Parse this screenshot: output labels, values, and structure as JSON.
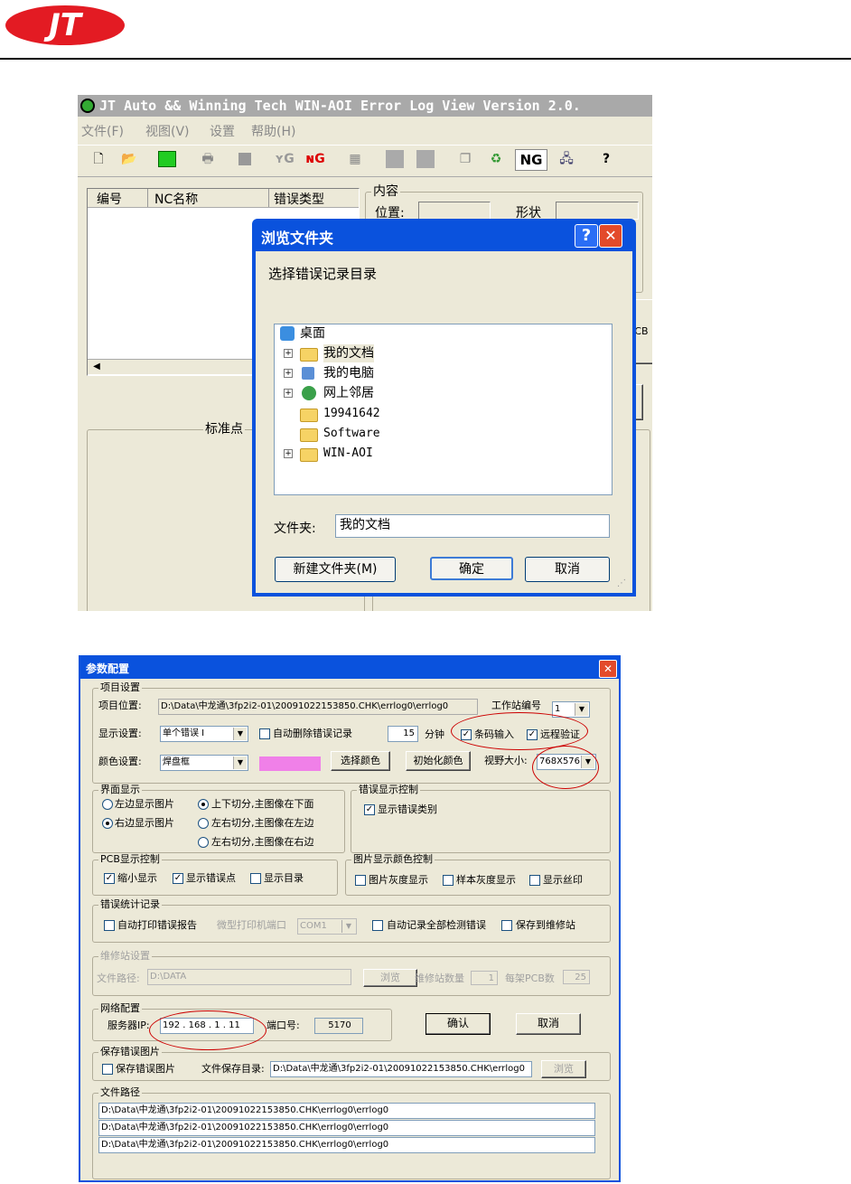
{
  "logo": {
    "text": "JT",
    "color": "#e31b23"
  },
  "viewer": {
    "title": "JT Auto && Winning Tech WIN-AOI Error Log View Version 2.0.",
    "menu": [
      "文件(F)",
      "视图(V)",
      "设置",
      "帮助(H)"
    ],
    "toolbar": {
      "ng_label": "NG",
      "icons": [
        "new-icon",
        "open-icon",
        "board-icon",
        "print-icon",
        "stop-icon",
        "good-icon",
        "ng-icon",
        "save-icon",
        "prev-icon",
        "next-icon",
        "copy-icon",
        "recycle-icon",
        "ng-text-icon",
        "network-icon",
        "help-icon"
      ]
    },
    "columns": [
      "编号",
      "NC名称",
      "错误类型"
    ],
    "content_group": "内容",
    "position_label": "位置:",
    "shape_label": "形状",
    "std_point_label": "标准点",
    "side_fragment": "CB"
  },
  "browse_dialog": {
    "title": "浏览文件夹",
    "prompt": "选择错误记录目录",
    "tree": [
      {
        "label": "桌面",
        "expand": false
      },
      {
        "label": "我的文档",
        "expand": true
      },
      {
        "label": "我的电脑",
        "expand": true
      },
      {
        "label": "网上邻居",
        "expand": true
      },
      {
        "label": "19941642",
        "expand": false
      },
      {
        "label": "Software",
        "expand": false
      },
      {
        "label": "WIN-AOI",
        "expand": true
      }
    ],
    "folder_label": "文件夹:",
    "folder_value": "我的文档",
    "new_folder_button": "新建文件夹(M)",
    "ok_button": "确定",
    "cancel_button": "取消"
  },
  "config_dialog": {
    "title": "参数配置",
    "project": {
      "group": "项目设置",
      "location_label": "项目位置:",
      "location_value": "D:\\Data\\中龙通\\3fp2i2-01\\20091022153850.CHK\\errlog0\\errlog0",
      "station_label": "工作站编号",
      "station_value": "1",
      "display_label": "显示设置:",
      "display_value": "单个错误 I",
      "auto_delete": "自动删除错误记录",
      "minutes_value": "15",
      "minutes_label": "分钟",
      "barcode": "条码输入",
      "remote": "远程验证",
      "color_label": "颜色设置:",
      "color_value": "焊盘框",
      "color_swatch": "#f080e8",
      "choose_color": "选择颜色",
      "init_color": "初始化颜色",
      "view_size_label": "视野大小:",
      "view_size_value": "768X576"
    },
    "interface": {
      "group": "界面显示",
      "left": "左边显示图片",
      "right": "右边显示图片",
      "split1": "上下切分,主图像在下面",
      "split2": "左右切分,主图像在左边",
      "split3": "左右切分,主图像在右边"
    },
    "error_display": {
      "group": "错误显示控制",
      "show_type": "显示错误类别"
    },
    "pcb": {
      "group": "PCB显示控制",
      "shrink": "缩小显示",
      "show_error": "显示错误点",
      "show_dir": "显示目录"
    },
    "image_color": {
      "group": "图片显示颜色控制",
      "gray": "图片灰度显示",
      "sample_gray": "样本灰度显示",
      "silk": "显示丝印"
    },
    "stats": {
      "group": "错误统计记录",
      "auto_print": "自动打印错误报告",
      "printer_port_label": "微型打印机端口",
      "printer_port_value": "COM1",
      "auto_record": "自动记录全部检测错误",
      "save_repair": "保存到维修站"
    },
    "repair": {
      "group": "维修站设置",
      "path_label": "文件路径:",
      "path_value": "D:\\DATA",
      "browse": "浏览",
      "count_label": "维修站数量",
      "count_value": "1",
      "per_rack_label": "每架PCB数",
      "per_rack_value": "25"
    },
    "network": {
      "group": "网络配置",
      "ip_label": "服务器IP:",
      "ip_value": "192 . 168 .  1  . 11",
      "port_label": "端口号:",
      "port_value": "5170"
    },
    "confirm_button": "确认",
    "cancel_button": "取消",
    "save_images": {
      "group": "保存错误图片",
      "save_label": "保存错误图片",
      "dir_label": "文件保存目录:",
      "dir_value": "D:\\Data\\中龙通\\3fp2i2-01\\20091022153850.CHK\\errlog0",
      "browse": "浏览"
    },
    "file_paths": {
      "group": "文件路径",
      "rows": [
        "D:\\Data\\中龙通\\3fp2i2-01\\20091022153850.CHK\\errlog0\\errlog0",
        "D:\\Data\\中龙通\\3fp2i2-01\\20091022153850.CHK\\errlog0\\errlog0",
        "D:\\Data\\中龙通\\3fp2i2-01\\20091022153850.CHK\\errlog0\\errlog0"
      ]
    }
  }
}
